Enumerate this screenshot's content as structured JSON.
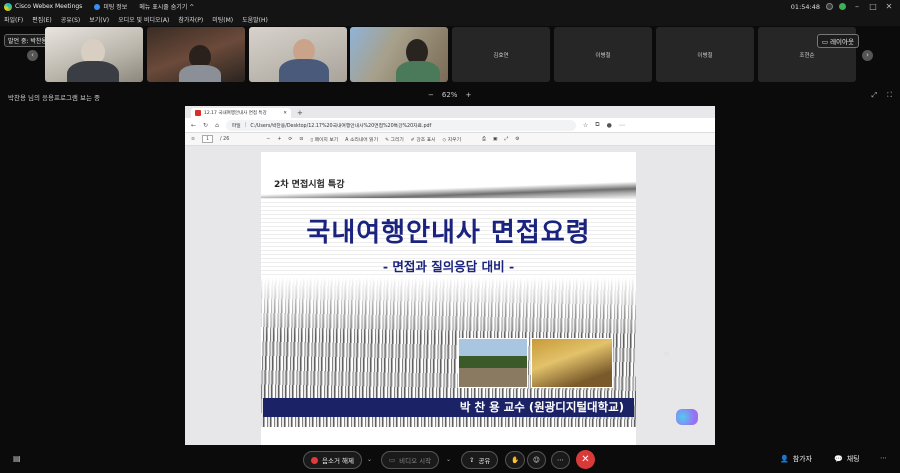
{
  "titlebar": {
    "app_name": "Cisco Webex Meetings",
    "meeting_info": "미팅 정보",
    "hide_menu": "메뉴 표시줄 숨기기 ^",
    "clock": "01:54:48"
  },
  "menubar": {
    "items": [
      "파일(F)",
      "편집(E)",
      "공유(S)",
      "보기(V)",
      "오디오 및 비디오(A)",
      "참가자(P)",
      "미팅(M)",
      "도움말(H)"
    ]
  },
  "strip": {
    "speaker_badge": "발언 중: 박찬용",
    "layout_button": "레이아웃",
    "name_tiles": [
      "김효연",
      "이병철",
      "이병철",
      "조현순"
    ]
  },
  "sharebar": {
    "status": "박찬용 님의 응용프로그램 보는 중",
    "zoom_minus": "−",
    "zoom": "62%",
    "zoom_plus": "+"
  },
  "browser": {
    "tab_title": "12.17 국내여행안내사 면접 특강",
    "new_tab": "+",
    "file_label": "파일",
    "address": "C:/Users/박찬용/Desktop/12.17%20국내여행안내사%20면접%20특강%20자료.pdf",
    "page_current": "1",
    "page_total": "/ 26",
    "tools": [
      "페이지 보기",
      "소리내어 읽기",
      "그리기",
      "강조 표시",
      "지우기"
    ]
  },
  "slide": {
    "subtitle": "2차 면접시험 특강",
    "title": "국내여행안내사 면접요령",
    "tagline": "- 면접과 질의응답 대비 -",
    "presenter": "박 찬 용 교수 (원광디지털대학교)"
  },
  "bottombar": {
    "mute_label": "음소거 해제",
    "video_label": "비디오 시작",
    "share_label": "공유",
    "participants_label": "참가자",
    "chat_label": "채팅"
  }
}
